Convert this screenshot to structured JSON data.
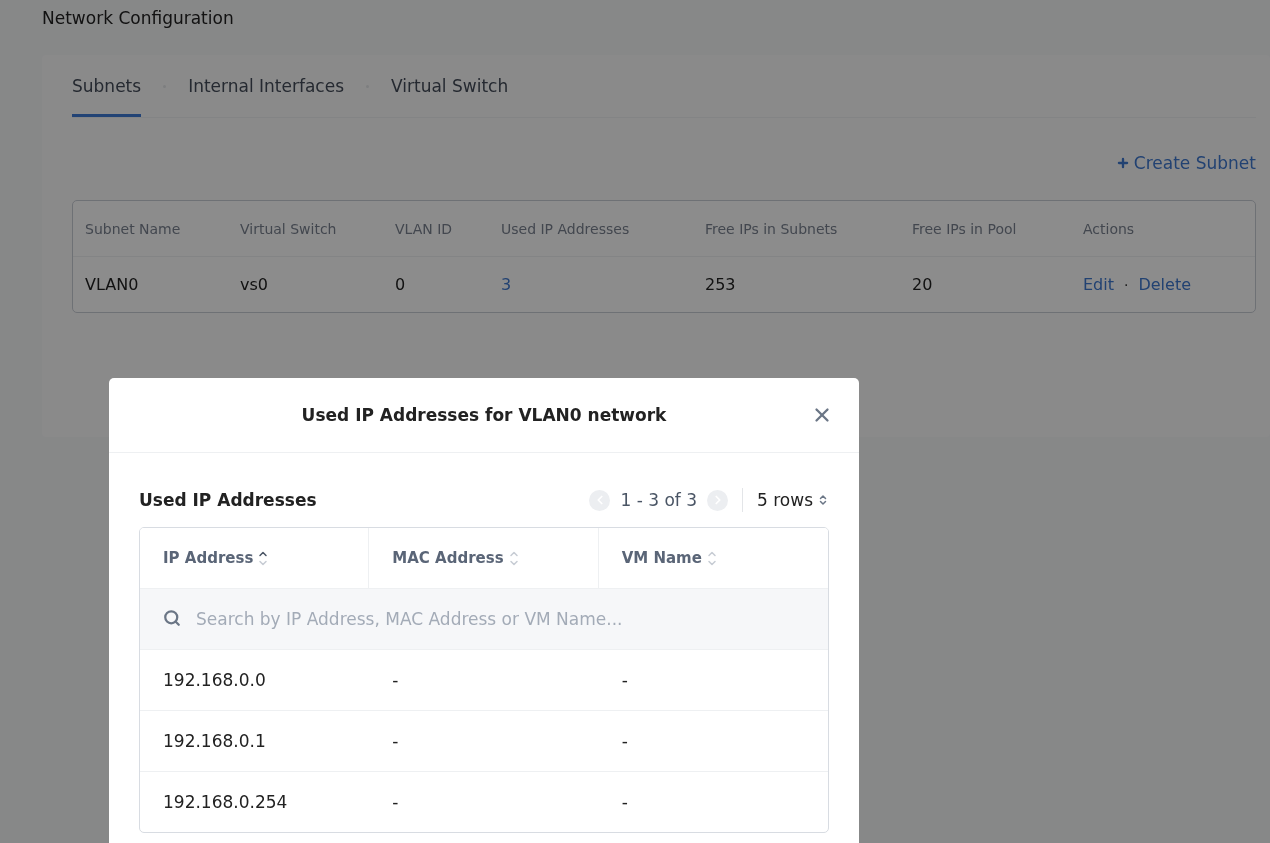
{
  "page_title": "Network Configuration",
  "tabs": [
    {
      "label": "Subnets",
      "selected": true
    },
    {
      "label": "Internal Interfaces",
      "selected": false
    },
    {
      "label": "Virtual Switch",
      "selected": false
    }
  ],
  "create_button": "Create Subnet",
  "subnets": {
    "columns": [
      "Subnet Name",
      "Virtual Switch",
      "VLAN ID",
      "Used IP Addresses",
      "Free IPs in Subnets",
      "Free IPs in Pool",
      "Actions"
    ],
    "rows": [
      {
        "name": "VLAN0",
        "switch": "vs0",
        "vlan_id": "0",
        "used_ips": "3",
        "free_subnet": "253",
        "free_pool": "20",
        "actions": [
          "Edit",
          "Delete"
        ],
        "action_separator": "·"
      }
    ]
  },
  "dialog": {
    "title": "Used IP Addresses for VLAN0 network",
    "section_title": "Used IP Addresses",
    "pagination": {
      "range": "1 - 3 of 3",
      "prev_disabled": true,
      "next_disabled": true,
      "page_size": "5 rows"
    },
    "columns": [
      {
        "label": "IP Address",
        "sorted": true
      },
      {
        "label": "MAC Address",
        "sorted": false
      },
      {
        "label": "VM Name",
        "sorted": false
      }
    ],
    "search": {
      "placeholder": "Search by IP Address, MAC Address or VM Name..."
    },
    "rows": [
      [
        "192.168.0.0",
        "-",
        "-"
      ],
      [
        "192.168.0.1",
        "-",
        "-"
      ],
      [
        "192.168.0.254",
        "-",
        "-"
      ]
    ]
  }
}
